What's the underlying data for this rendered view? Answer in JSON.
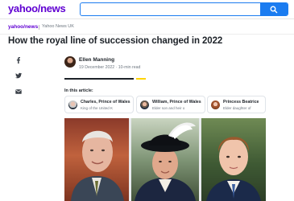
{
  "header": {
    "logo": "yahoo/news",
    "search_placeholder": ""
  },
  "subheader": {
    "logo": "yahoo/news",
    "section": "Yahoo News UK"
  },
  "article": {
    "headline": "How the royal line of succession changed in 2022",
    "author": "Ellen Manning",
    "date": "19 December 2022 · 10-min read",
    "in_this_article_label": "In this article:"
  },
  "share_icons": [
    "facebook-icon",
    "twitter-icon",
    "mail-icon"
  ],
  "cards": [
    {
      "name": "Charles, Prince of Wales",
      "desc": "King of the United K"
    },
    {
      "name": "William, Prince of Wales",
      "desc": "Elder son and heir o"
    },
    {
      "name": "Princess Beatrice",
      "desc": "Elder daughter of"
    }
  ],
  "colors": {
    "brand": "#6001d2",
    "search_blue": "#1b7cf0",
    "accent_yellow": "#ffd400",
    "text": "#1d2228"
  }
}
